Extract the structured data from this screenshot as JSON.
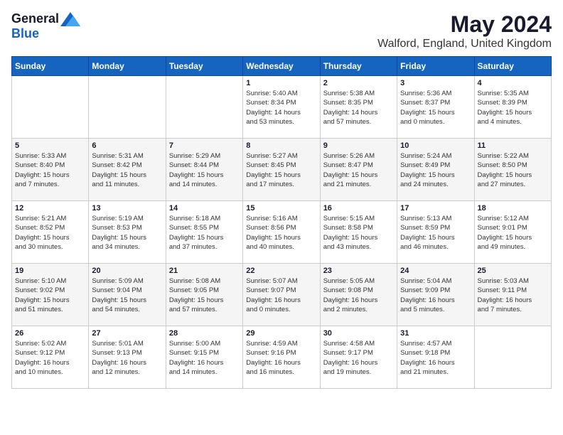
{
  "logo": {
    "general": "General",
    "blue": "Blue"
  },
  "title": "May 2024",
  "subtitle": "Walford, England, United Kingdom",
  "days_of_week": [
    "Sunday",
    "Monday",
    "Tuesday",
    "Wednesday",
    "Thursday",
    "Friday",
    "Saturday"
  ],
  "weeks": [
    [
      {
        "day": "",
        "info": ""
      },
      {
        "day": "",
        "info": ""
      },
      {
        "day": "",
        "info": ""
      },
      {
        "day": "1",
        "info": "Sunrise: 5:40 AM\nSunset: 8:34 PM\nDaylight: 14 hours\nand 53 minutes."
      },
      {
        "day": "2",
        "info": "Sunrise: 5:38 AM\nSunset: 8:35 PM\nDaylight: 14 hours\nand 57 minutes."
      },
      {
        "day": "3",
        "info": "Sunrise: 5:36 AM\nSunset: 8:37 PM\nDaylight: 15 hours\nand 0 minutes."
      },
      {
        "day": "4",
        "info": "Sunrise: 5:35 AM\nSunset: 8:39 PM\nDaylight: 15 hours\nand 4 minutes."
      }
    ],
    [
      {
        "day": "5",
        "info": "Sunrise: 5:33 AM\nSunset: 8:40 PM\nDaylight: 15 hours\nand 7 minutes."
      },
      {
        "day": "6",
        "info": "Sunrise: 5:31 AM\nSunset: 8:42 PM\nDaylight: 15 hours\nand 11 minutes."
      },
      {
        "day": "7",
        "info": "Sunrise: 5:29 AM\nSunset: 8:44 PM\nDaylight: 15 hours\nand 14 minutes."
      },
      {
        "day": "8",
        "info": "Sunrise: 5:27 AM\nSunset: 8:45 PM\nDaylight: 15 hours\nand 17 minutes."
      },
      {
        "day": "9",
        "info": "Sunrise: 5:26 AM\nSunset: 8:47 PM\nDaylight: 15 hours\nand 21 minutes."
      },
      {
        "day": "10",
        "info": "Sunrise: 5:24 AM\nSunset: 8:49 PM\nDaylight: 15 hours\nand 24 minutes."
      },
      {
        "day": "11",
        "info": "Sunrise: 5:22 AM\nSunset: 8:50 PM\nDaylight: 15 hours\nand 27 minutes."
      }
    ],
    [
      {
        "day": "12",
        "info": "Sunrise: 5:21 AM\nSunset: 8:52 PM\nDaylight: 15 hours\nand 30 minutes."
      },
      {
        "day": "13",
        "info": "Sunrise: 5:19 AM\nSunset: 8:53 PM\nDaylight: 15 hours\nand 34 minutes."
      },
      {
        "day": "14",
        "info": "Sunrise: 5:18 AM\nSunset: 8:55 PM\nDaylight: 15 hours\nand 37 minutes."
      },
      {
        "day": "15",
        "info": "Sunrise: 5:16 AM\nSunset: 8:56 PM\nDaylight: 15 hours\nand 40 minutes."
      },
      {
        "day": "16",
        "info": "Sunrise: 5:15 AM\nSunset: 8:58 PM\nDaylight: 15 hours\nand 43 minutes."
      },
      {
        "day": "17",
        "info": "Sunrise: 5:13 AM\nSunset: 8:59 PM\nDaylight: 15 hours\nand 46 minutes."
      },
      {
        "day": "18",
        "info": "Sunrise: 5:12 AM\nSunset: 9:01 PM\nDaylight: 15 hours\nand 49 minutes."
      }
    ],
    [
      {
        "day": "19",
        "info": "Sunrise: 5:10 AM\nSunset: 9:02 PM\nDaylight: 15 hours\nand 51 minutes."
      },
      {
        "day": "20",
        "info": "Sunrise: 5:09 AM\nSunset: 9:04 PM\nDaylight: 15 hours\nand 54 minutes."
      },
      {
        "day": "21",
        "info": "Sunrise: 5:08 AM\nSunset: 9:05 PM\nDaylight: 15 hours\nand 57 minutes."
      },
      {
        "day": "22",
        "info": "Sunrise: 5:07 AM\nSunset: 9:07 PM\nDaylight: 16 hours\nand 0 minutes."
      },
      {
        "day": "23",
        "info": "Sunrise: 5:05 AM\nSunset: 9:08 PM\nDaylight: 16 hours\nand 2 minutes."
      },
      {
        "day": "24",
        "info": "Sunrise: 5:04 AM\nSunset: 9:09 PM\nDaylight: 16 hours\nand 5 minutes."
      },
      {
        "day": "25",
        "info": "Sunrise: 5:03 AM\nSunset: 9:11 PM\nDaylight: 16 hours\nand 7 minutes."
      }
    ],
    [
      {
        "day": "26",
        "info": "Sunrise: 5:02 AM\nSunset: 9:12 PM\nDaylight: 16 hours\nand 10 minutes."
      },
      {
        "day": "27",
        "info": "Sunrise: 5:01 AM\nSunset: 9:13 PM\nDaylight: 16 hours\nand 12 minutes."
      },
      {
        "day": "28",
        "info": "Sunrise: 5:00 AM\nSunset: 9:15 PM\nDaylight: 16 hours\nand 14 minutes."
      },
      {
        "day": "29",
        "info": "Sunrise: 4:59 AM\nSunset: 9:16 PM\nDaylight: 16 hours\nand 16 minutes."
      },
      {
        "day": "30",
        "info": "Sunrise: 4:58 AM\nSunset: 9:17 PM\nDaylight: 16 hours\nand 19 minutes."
      },
      {
        "day": "31",
        "info": "Sunrise: 4:57 AM\nSunset: 9:18 PM\nDaylight: 16 hours\nand 21 minutes."
      },
      {
        "day": "",
        "info": ""
      }
    ]
  ]
}
